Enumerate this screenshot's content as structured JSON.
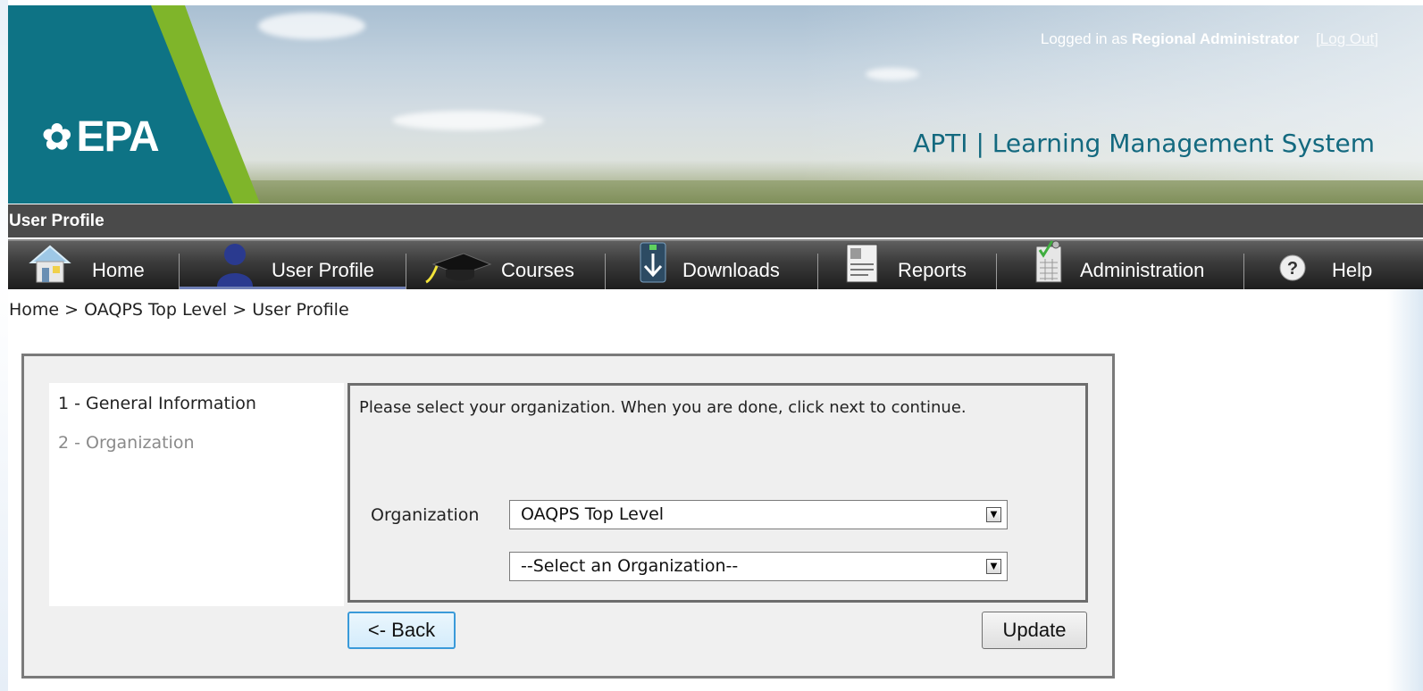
{
  "header": {
    "logo_text": "EPA",
    "logged_in_prefix": "Logged in as",
    "user_role": "Regional Administrator",
    "logout_label": "[Log Out]",
    "system_title": "APTI | Learning Management System"
  },
  "title_bar": {
    "label": "User Profile"
  },
  "nav": {
    "items": [
      {
        "label": "Home",
        "icon": "home-icon"
      },
      {
        "label": "User Profile",
        "icon": "user-icon",
        "active": true
      },
      {
        "label": "Courses",
        "icon": "graduation-cap-icon"
      },
      {
        "label": "Downloads",
        "icon": "download-icon"
      },
      {
        "label": "Reports",
        "icon": "report-icon"
      },
      {
        "label": "Administration",
        "icon": "clipboard-check-icon"
      },
      {
        "label": "Help",
        "icon": "help-icon"
      }
    ]
  },
  "breadcrumb": {
    "items": [
      "Home",
      "OAQPS Top Level",
      "User Profile"
    ],
    "separator": ">"
  },
  "wizard": {
    "steps": [
      {
        "label": "1 - General Information",
        "state": "completed"
      },
      {
        "label": "2 - Organization",
        "state": "current"
      }
    ],
    "instruction": "Please select your organization. When you are done, click next to continue.",
    "organization_label": "Organization",
    "organization_select_1": "OAQPS Top Level",
    "organization_select_2": "--Select an Organization--",
    "back_button": "<- Back",
    "update_button": "Update"
  },
  "colors": {
    "brand_teal": "#0e7385",
    "accent_green": "#7fb52a",
    "title_teal": "#13697f",
    "bar_dark": "#4a4a4a"
  }
}
